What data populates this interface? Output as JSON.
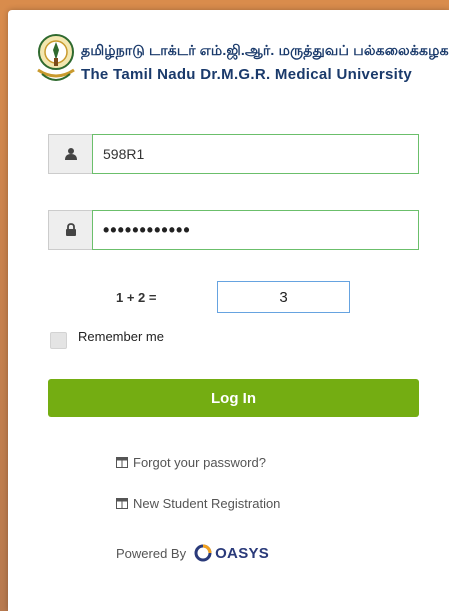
{
  "brand": {
    "tamil_name": "தமிழ்நாடு டாக்டர் எம்.ஜி.ஆர். மருத்துவப் பல்கலைக்கழகம்",
    "english_name": "The Tamil Nadu Dr.M.G.R. Medical University"
  },
  "login": {
    "username_value": "598R1",
    "password_value": "••••••••••••",
    "captcha_question": "1 + 2 =",
    "captcha_value": "3",
    "remember_label": "Remember me",
    "login_button": "Log In"
  },
  "links": {
    "forgot_password": "Forgot your password?",
    "new_registration": "New Student Registration"
  },
  "footer": {
    "powered_by": "Powered By",
    "vendor": "OASYS"
  },
  "colors": {
    "accent_green": "#74ad12",
    "field_border_green": "#6bbf6b",
    "captcha_border_blue": "#66a3e0",
    "brand_blue": "#1a3a6b"
  },
  "icons": {
    "username": "user-icon",
    "password": "lock-icon",
    "links": "window-icon",
    "vendor": "oasys-logo-icon",
    "university": "university-emblem"
  }
}
